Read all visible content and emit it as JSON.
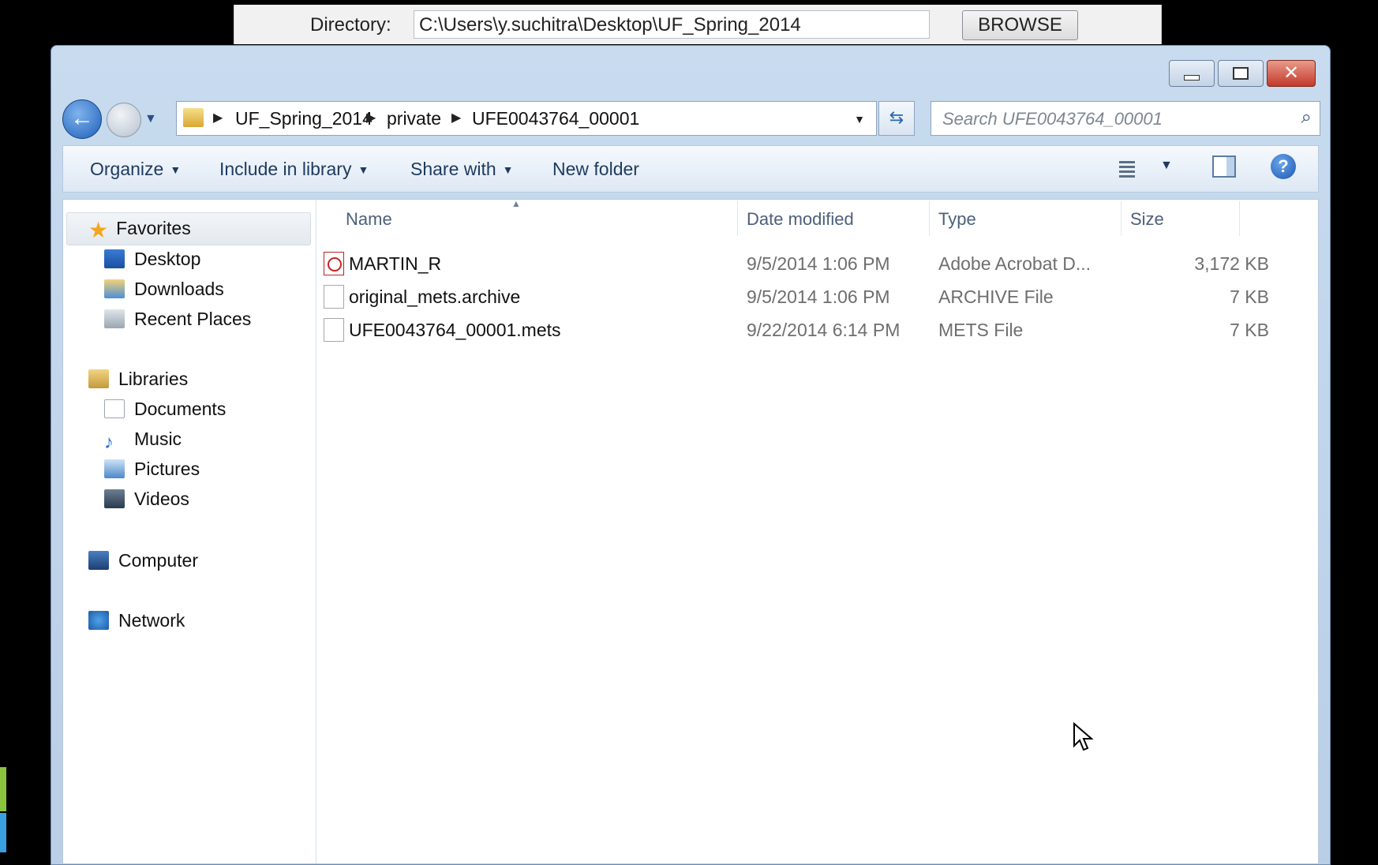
{
  "background_app": {
    "directory_label": "Directory:",
    "directory_value": "C:\\Users\\y.suchitra\\Desktop\\UF_Spring_2014",
    "browse_label": "BROWSE"
  },
  "window": {
    "caption": {
      "minimize": "",
      "maximize": "",
      "close": "✕"
    },
    "address": {
      "crumbs": [
        "UF_Spring_2014",
        "private",
        "UFE0043764_00001"
      ],
      "separator": "▶"
    },
    "search_placeholder": "Search UFE0043764_00001",
    "toolbar": {
      "organize": "Organize",
      "include_in_library": "Include in library",
      "share_with": "Share with",
      "new_folder": "New folder"
    },
    "nav": {
      "favorites": "Favorites",
      "desktop": "Desktop",
      "downloads": "Downloads",
      "recent_places": "Recent Places",
      "libraries": "Libraries",
      "documents": "Documents",
      "music": "Music",
      "pictures": "Pictures",
      "videos": "Videos",
      "computer": "Computer",
      "network": "Network"
    },
    "columns": {
      "name": "Name",
      "date": "Date modified",
      "type": "Type",
      "size": "Size"
    },
    "files": [
      {
        "name": "MARTIN_R",
        "date": "9/5/2014 1:06 PM",
        "type": "Adobe Acrobat D...",
        "size": "3,172 KB",
        "icon": "pdf-icon"
      },
      {
        "name": "original_mets.archive",
        "date": "9/5/2014 1:06 PM",
        "type": "ARCHIVE File",
        "size": "7 KB",
        "icon": "file-icon"
      },
      {
        "name": "UFE0043764_00001.mets",
        "date": "9/22/2014 6:14 PM",
        "type": "METS File",
        "size": "7 KB",
        "icon": "file-icon"
      }
    ]
  }
}
